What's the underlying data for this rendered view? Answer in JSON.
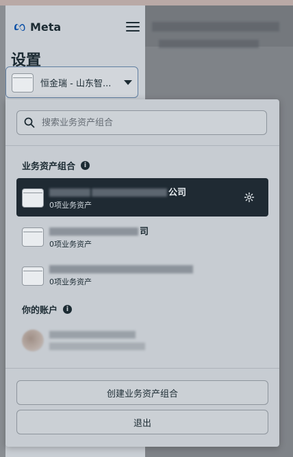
{
  "header": {
    "brand": "Meta",
    "page_title": "设置"
  },
  "account_selector": {
    "selected_label": "恒金瑞 - 山东智..."
  },
  "search": {
    "placeholder": "搜索业务资产组合"
  },
  "sections": {
    "portfolios_title": "业务资产组合",
    "accounts_title": "你的账户"
  },
  "portfolios": [
    {
      "name_visible": "公司",
      "sub": "0项业务资产",
      "selected": true
    },
    {
      "name_visible": "司",
      "sub": "0项业务资产",
      "selected": false
    },
    {
      "name_visible": "",
      "sub": "0项业务资产",
      "selected": false
    }
  ],
  "buttons": {
    "create": "创建业务资产组合",
    "logout": "退出"
  },
  "icons": {
    "info": "info-icon",
    "gear": "gear-icon",
    "search": "search-icon",
    "menu": "hamburger-menu-icon",
    "briefcase": "briefcase-icon"
  },
  "colors": {
    "selected_row": "#1f2a33",
    "select_border": "#5f7ea1"
  }
}
